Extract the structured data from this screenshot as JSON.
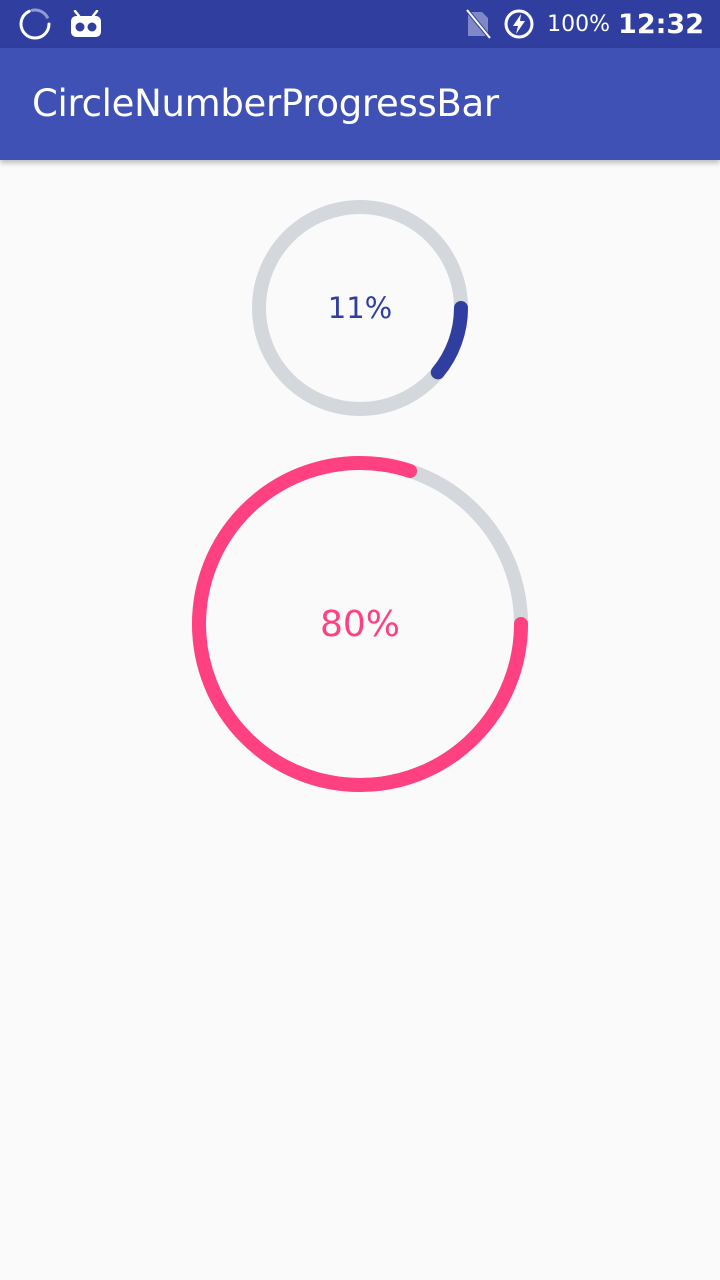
{
  "status_bar": {
    "left_icons": [
      "sync-spinner-icon",
      "android-debug-icon"
    ],
    "right_icons": [
      "no-sim-icon",
      "battery-charging-icon"
    ],
    "battery": "100%",
    "clock": "12:32"
  },
  "app_bar": {
    "title": "CircleNumberProgressBar"
  },
  "progress_bars": [
    {
      "value": 11,
      "label": "11%",
      "color": "#303f9f",
      "track_color": "#d4d7dc",
      "start": "right (3 o'clock)",
      "direction": "clockwise"
    },
    {
      "value": 80,
      "label": "80%",
      "color": "#ff4081",
      "track_color": "#d4d7dc",
      "start": "right (3 o'clock)",
      "direction": "clockwise"
    }
  ],
  "colors": {
    "status_bar": "#303f9f",
    "app_bar": "#3f51b5",
    "background": "#fafafa"
  }
}
